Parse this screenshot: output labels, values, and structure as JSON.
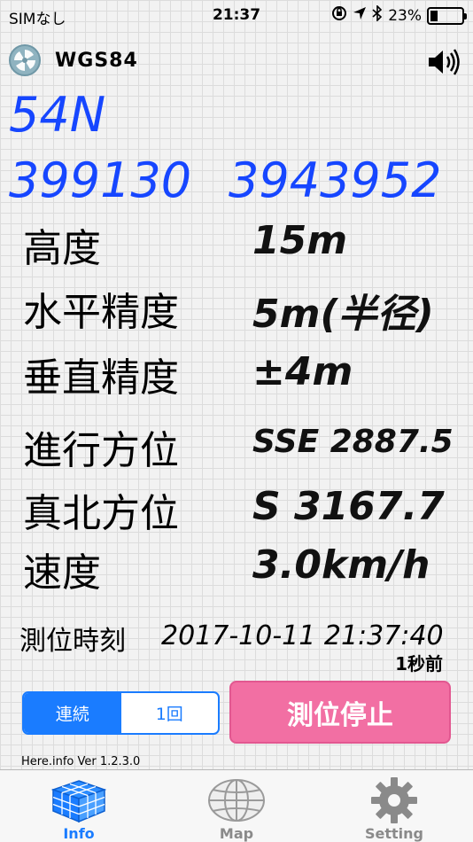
{
  "status_bar": {
    "carrier": "SIMなし",
    "time": "21:37",
    "battery_percent": "23%",
    "battery_level": 0.23
  },
  "header": {
    "datum": "WGS84"
  },
  "coordinates": {
    "zone": "54N",
    "easting": "399130",
    "northing": "3943952"
  },
  "rows": [
    {
      "label": "高度",
      "value": "15m"
    },
    {
      "label": "水平精度",
      "value": "5m(半径)"
    },
    {
      "label": "垂直精度",
      "value": "±4m"
    },
    {
      "label": "進行方位",
      "value": "SSE 2887.5"
    },
    {
      "label": "真北方位",
      "value": "S 3167.7"
    },
    {
      "label": "速度",
      "value": "3.0km/h"
    }
  ],
  "fix_time": {
    "label": "測位時刻",
    "value": "2017-10-11 21:37:40",
    "ago": "1秒前"
  },
  "mode_segment": {
    "continuous": "連続",
    "once": "1回",
    "selected": "continuous"
  },
  "stop_button": "測位停止",
  "version": "Here.info Ver 1.2.3.0",
  "tabs": [
    {
      "label": "Info",
      "icon": "cube-grid-icon",
      "active": true
    },
    {
      "label": "Map",
      "icon": "globe-icon",
      "active": false
    },
    {
      "label": "Setting",
      "icon": "gear-icon",
      "active": false
    }
  ],
  "colors": {
    "coordinate_blue": "#1646ff",
    "accent_blue": "#1a7cff",
    "stop_pink": "#f26fa3"
  }
}
